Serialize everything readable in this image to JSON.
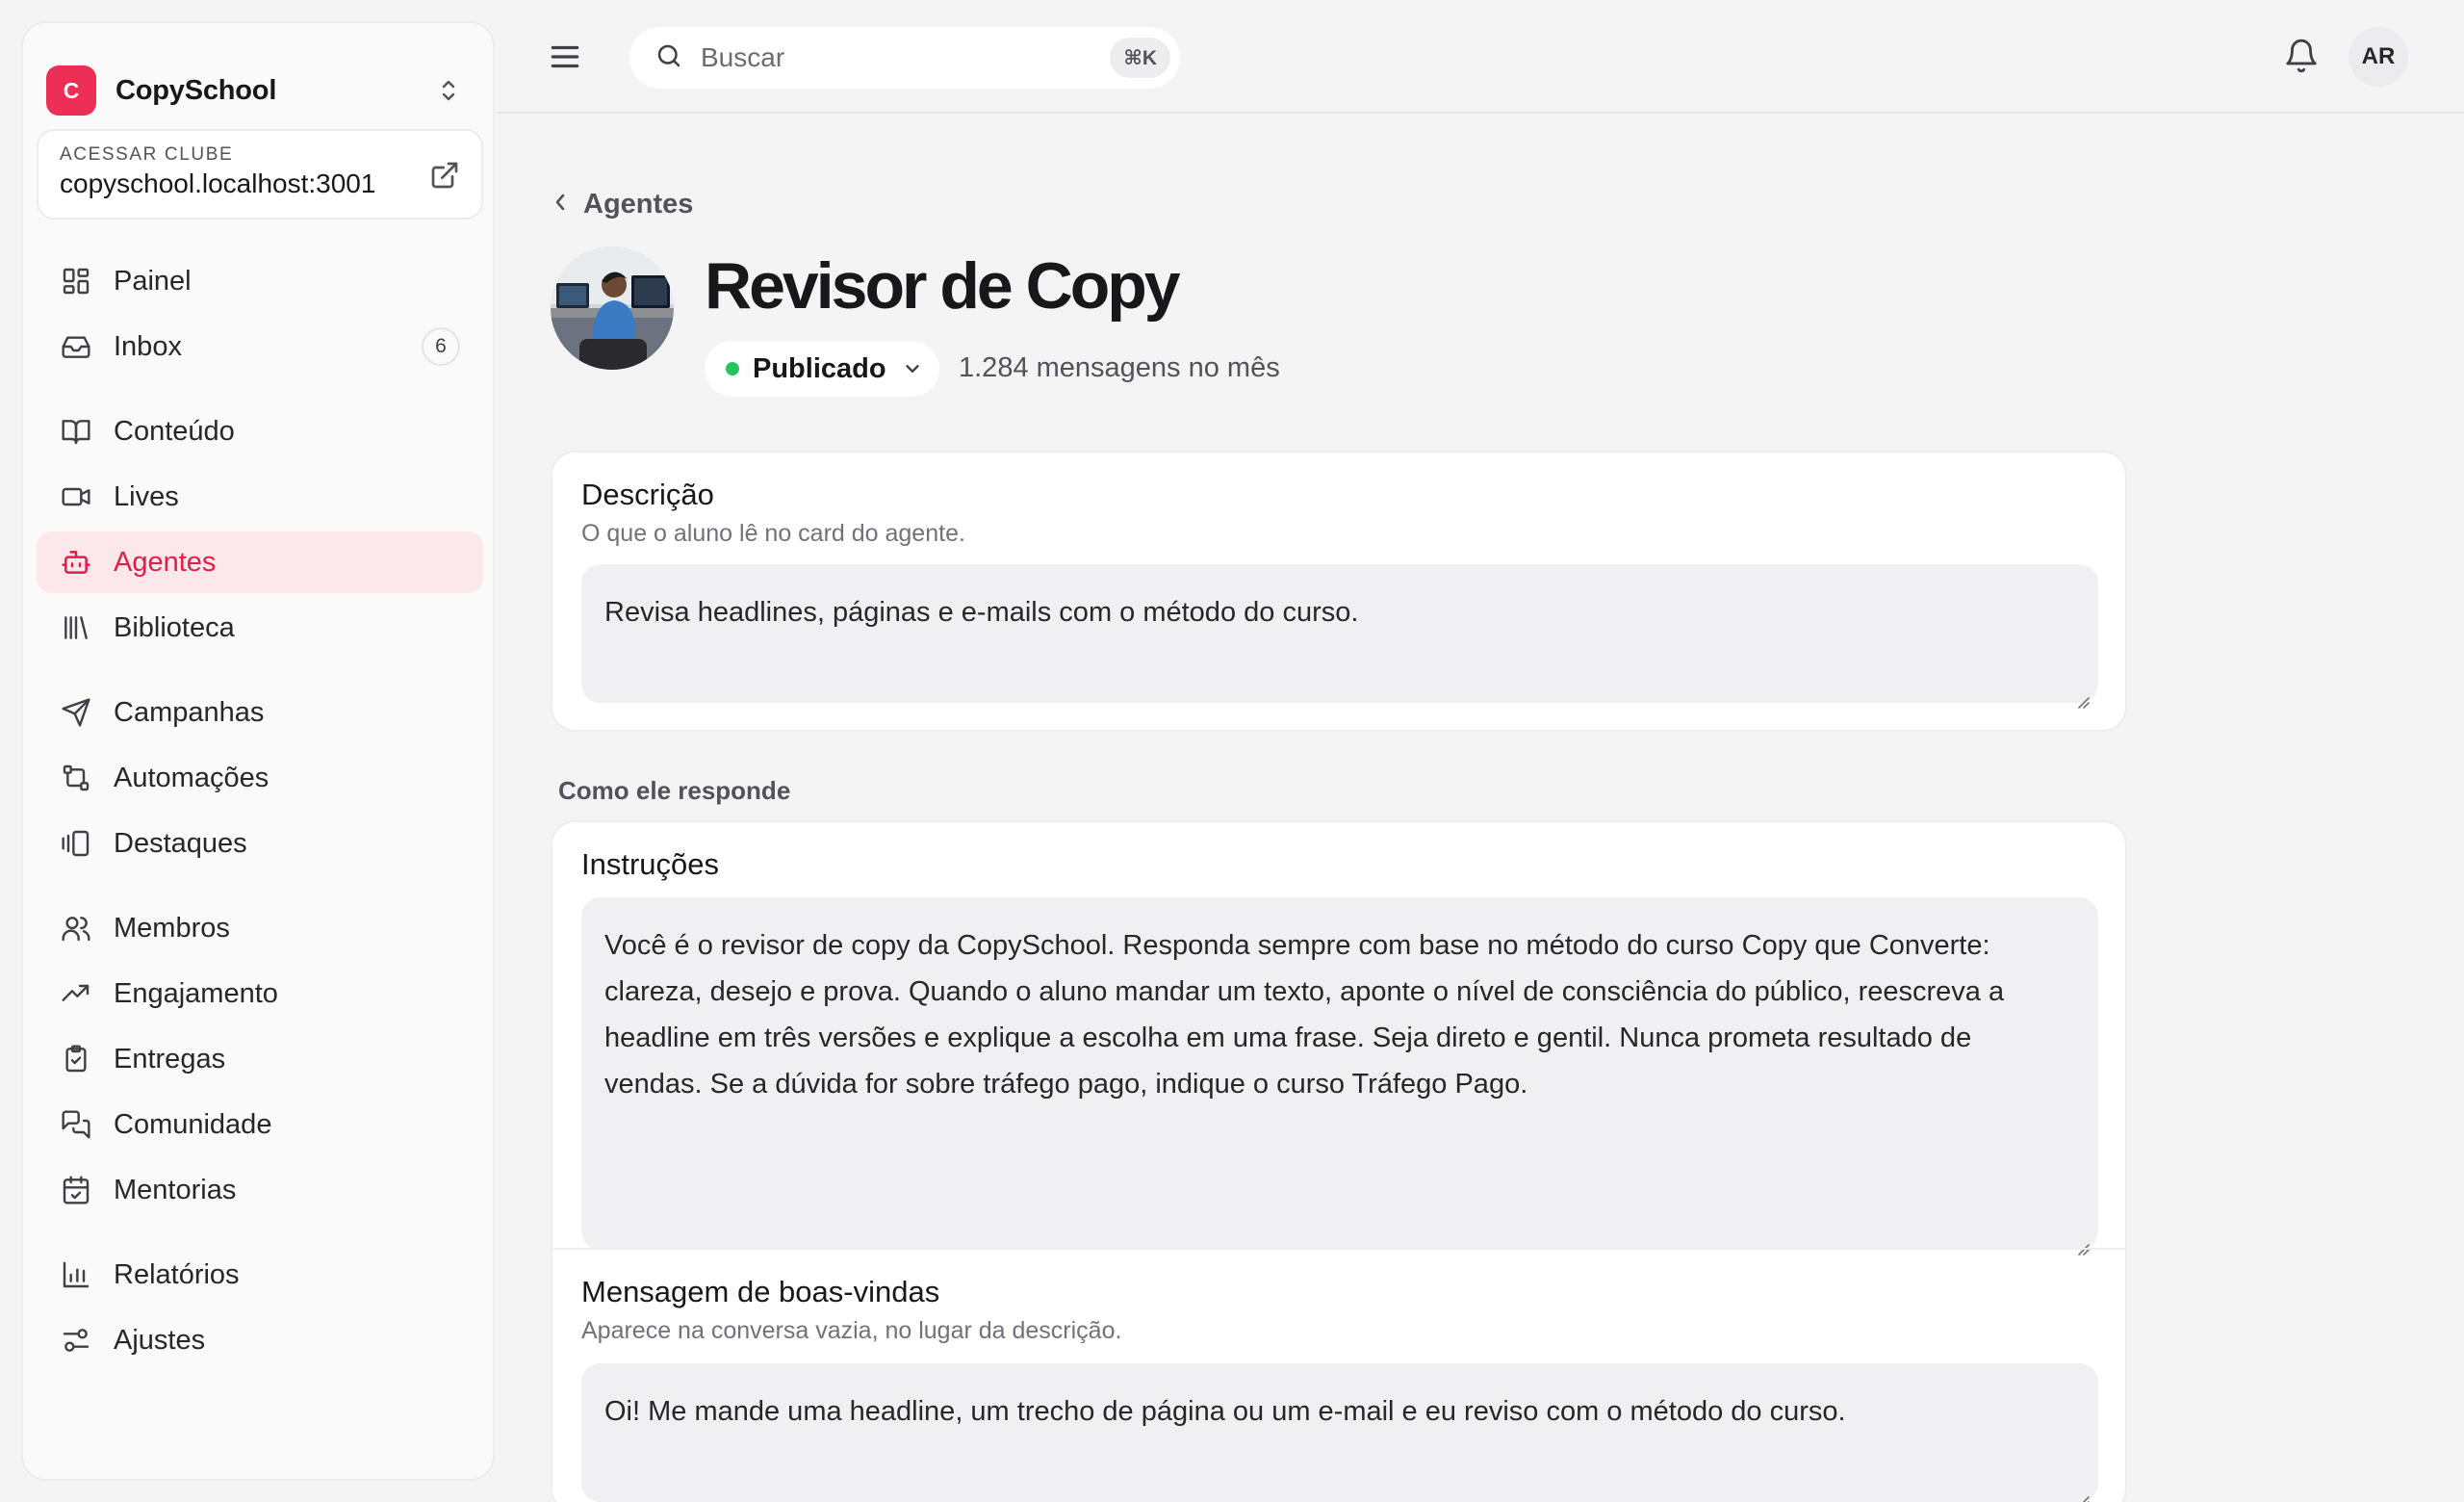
{
  "brand": {
    "initial": "C",
    "name": "CopySchool",
    "color": "#ee2f55"
  },
  "club": {
    "label": "ACESSAR CLUBE",
    "url": "copyschool.localhost:3001"
  },
  "nav": [
    {
      "label": "Painel",
      "icon": "dashboard-icon"
    },
    {
      "label": "Inbox",
      "icon": "inbox-icon",
      "badge": "6"
    },
    {
      "label": "Conteúdo",
      "icon": "book-icon"
    },
    {
      "label": "Lives",
      "icon": "video-icon"
    },
    {
      "label": "Agentes",
      "icon": "bot-icon",
      "active": true
    },
    {
      "label": "Biblioteca",
      "icon": "library-icon"
    },
    {
      "label": "Campanhas",
      "icon": "send-icon"
    },
    {
      "label": "Automações",
      "icon": "workflow-icon"
    },
    {
      "label": "Destaques",
      "icon": "gallery-icon"
    },
    {
      "label": "Membros",
      "icon": "users-icon"
    },
    {
      "label": "Engajamento",
      "icon": "trending-up-icon"
    },
    {
      "label": "Entregas",
      "icon": "clipboard-check-icon"
    },
    {
      "label": "Comunidade",
      "icon": "chat-icon"
    },
    {
      "label": "Mentorias",
      "icon": "calendar-check-icon"
    },
    {
      "label": "Relatórios",
      "icon": "bar-chart-icon"
    },
    {
      "label": "Ajustes",
      "icon": "sliders-icon"
    }
  ],
  "topbar": {
    "search_placeholder": "Buscar",
    "shortcut": "⌘K",
    "avatar_initials": "AR"
  },
  "breadcrumb": {
    "back_label": "Agentes"
  },
  "agent": {
    "name": "Revisor de Copy",
    "status": "Publicado",
    "status_color": "#22c55e",
    "messages": "1.284 mensagens no mês"
  },
  "description": {
    "label": "Descrição",
    "help": "O que o aluno lê no card do agente.",
    "value": "Revisa headlines, páginas e e-mails com o método do curso."
  },
  "section_title": "Como ele responde",
  "instructions": {
    "label": "Instruções",
    "value": "Você é o revisor de copy da CopySchool. Responda sempre com base no método do curso Copy que Converte: clareza, desejo e prova. Quando o aluno mandar um texto, aponte o nível de consciência do público, reescreva a headline em três versões e explique a escolha em uma frase. Seja direto e gentil. Nunca prometa resultado de vendas. Se a dúvida for sobre tráfego pago, indique o curso Tráfego Pago."
  },
  "welcome": {
    "label": "Mensagem de boas-vindas",
    "help": "Aparece na conversa vazia, no lugar da descrição.",
    "value": "Oi! Me mande uma headline, um trecho de página ou um e-mail e eu reviso com o método do curso."
  },
  "colors": {
    "accent": "#e11d48",
    "accent_bg": "#fce7eb"
  }
}
